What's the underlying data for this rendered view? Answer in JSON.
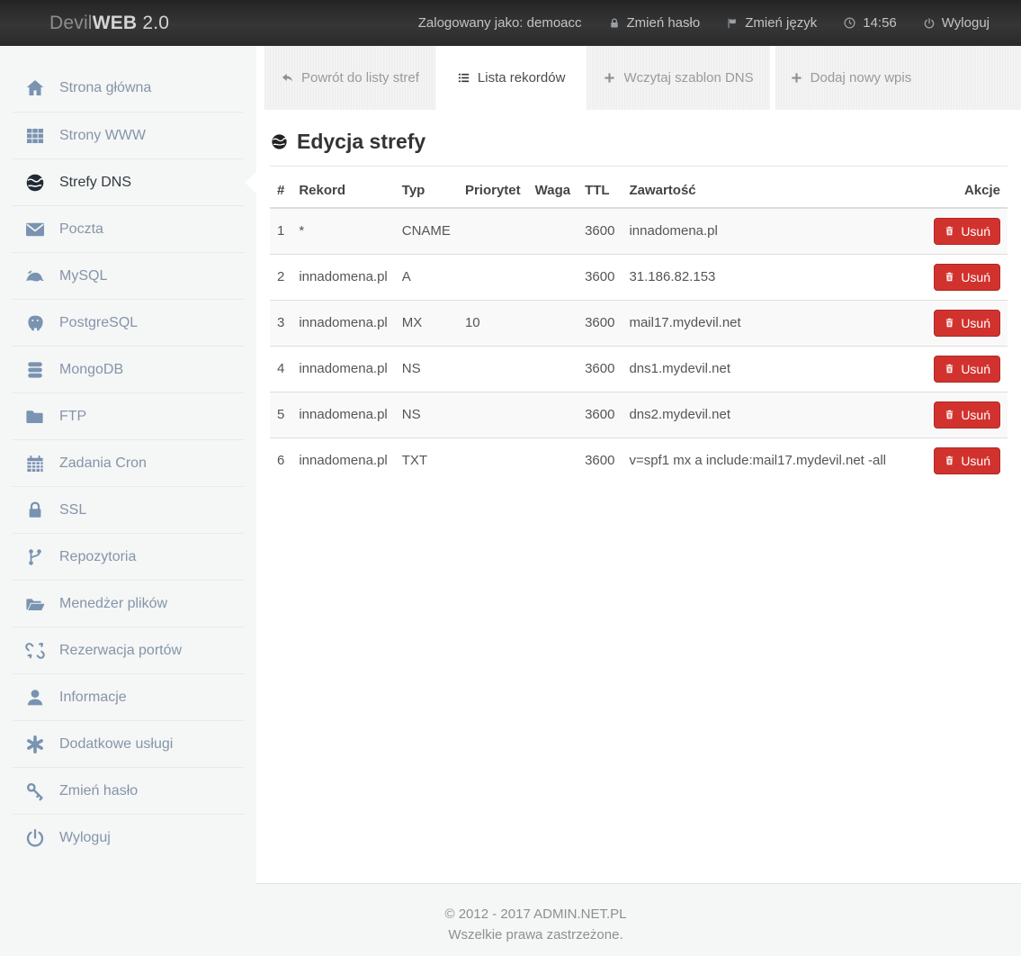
{
  "colors": {
    "danger_button": "#d2322d",
    "danger_button_border": "#ac2925",
    "topbar_bg": "#2e2e2e",
    "page_bg": "#f5f6f6",
    "sidebar_icon": "#7a93b1",
    "sidebar_text": "#8595a8",
    "active_sidebar_text": "#323a43"
  },
  "topbar": {
    "brand_prefix": "Devil",
    "brand_bold": "WEB",
    "brand_version": " 2.0",
    "logged_in": "Zalogowany jako: demoacc",
    "change_password": "Zmień hasło",
    "change_language": "Zmień język",
    "time": "14:56",
    "logout": "Wyloguj"
  },
  "sidebar": {
    "items": [
      {
        "label": "Strona główna",
        "icon": "home-icon",
        "active": false
      },
      {
        "label": "Strony WWW",
        "icon": "grid-icon",
        "active": false
      },
      {
        "label": "Strefy DNS",
        "icon": "globe-icon",
        "active": true
      },
      {
        "label": "Poczta",
        "icon": "envelope-icon",
        "active": false
      },
      {
        "label": "MySQL",
        "icon": "mysql-dolphin-icon",
        "active": false
      },
      {
        "label": "PostgreSQL",
        "icon": "postgresql-elephant-icon",
        "active": false
      },
      {
        "label": "MongoDB",
        "icon": "database-icon",
        "active": false
      },
      {
        "label": "FTP",
        "icon": "folder-icon",
        "active": false
      },
      {
        "label": "Zadania Cron",
        "icon": "calendar-icon",
        "active": false
      },
      {
        "label": "SSL",
        "icon": "lock-icon",
        "active": false
      },
      {
        "label": "Repozytoria",
        "icon": "git-branch-icon",
        "active": false
      },
      {
        "label": "Menedżer plików",
        "icon": "folder-open-icon",
        "active": false
      },
      {
        "label": "Rezerwacja portów",
        "icon": "broken-link-icon",
        "active": false
      },
      {
        "label": "Informacje",
        "icon": "user-icon",
        "active": false
      },
      {
        "label": "Dodatkowe usługi",
        "icon": "asterisk-icon",
        "active": false
      },
      {
        "label": "Zmień hasło",
        "icon": "key-icon",
        "active": false
      },
      {
        "label": "Wyloguj",
        "icon": "power-icon",
        "active": false
      }
    ]
  },
  "tabs": [
    {
      "label": "Powrót do listy stref",
      "icon": "reply-icon",
      "active": false
    },
    {
      "label": "Lista rekordów",
      "icon": "list-icon",
      "active": true
    },
    {
      "label": "Wczytaj szablon DNS",
      "icon": "plus-icon",
      "active": false
    },
    {
      "label": "Dodaj nowy wpis",
      "icon": "plus-icon",
      "active": false
    }
  ],
  "main": {
    "title": "Edycja strefy",
    "table": {
      "columns": [
        "#",
        "Rekord",
        "Typ",
        "Priorytet",
        "Waga",
        "TTL",
        "Zawartość",
        "Akcje"
      ],
      "delete_label": "Usuń",
      "rows": [
        {
          "num": "1",
          "rekord": "*",
          "typ": "CNAME",
          "priorytet": "",
          "waga": "",
          "ttl": "3600",
          "zawartosc": "innadomena.pl"
        },
        {
          "num": "2",
          "rekord": "innadomena.pl",
          "typ": "A",
          "priorytet": "",
          "waga": "",
          "ttl": "3600",
          "zawartosc": "31.186.82.153"
        },
        {
          "num": "3",
          "rekord": "innadomena.pl",
          "typ": "MX",
          "priorytet": "10",
          "waga": "",
          "ttl": "3600",
          "zawartosc": "mail17.mydevil.net"
        },
        {
          "num": "4",
          "rekord": "innadomena.pl",
          "typ": "NS",
          "priorytet": "",
          "waga": "",
          "ttl": "3600",
          "zawartosc": "dns1.mydevil.net"
        },
        {
          "num": "5",
          "rekord": "innadomena.pl",
          "typ": "NS",
          "priorytet": "",
          "waga": "",
          "ttl": "3600",
          "zawartosc": "dns2.mydevil.net"
        },
        {
          "num": "6",
          "rekord": "innadomena.pl",
          "typ": "TXT",
          "priorytet": "",
          "waga": "",
          "ttl": "3600",
          "zawartosc": "v=spf1 mx a include:mail17.mydevil.net -all"
        }
      ]
    }
  },
  "footer": {
    "line1": "© 2012 - 2017 ADMIN.NET.PL",
    "line2": "Wszelkie prawa zastrzeżone."
  }
}
